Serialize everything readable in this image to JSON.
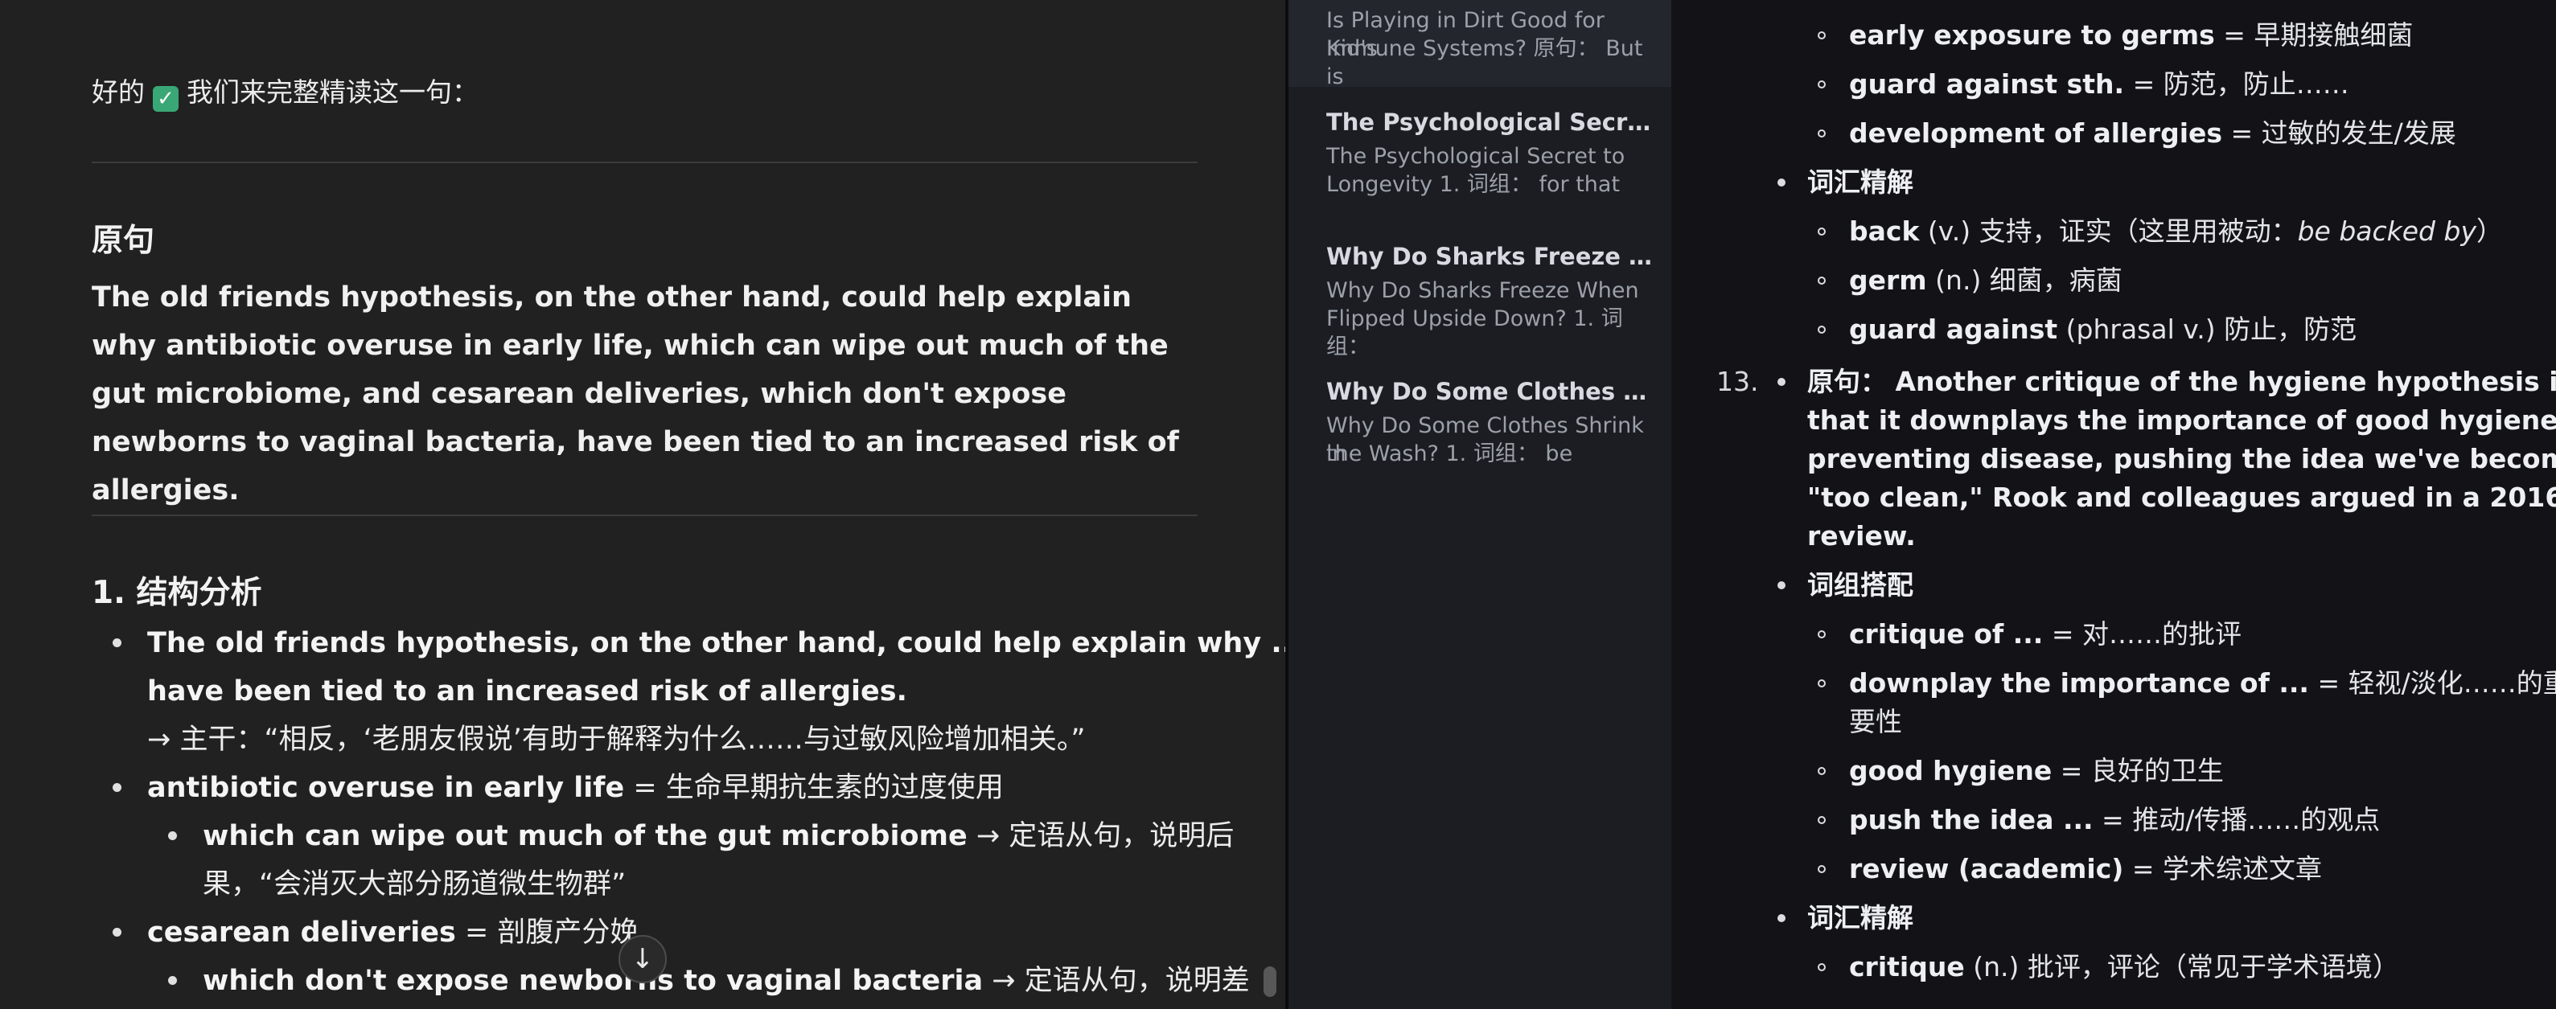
{
  "chat": {
    "intro_pre": "好的",
    "intro_post": "我们来完整精读这一句：",
    "original_heading": "原句",
    "original_sentence": "The old friends hypothesis, on the other hand, could help explain why antibiotic overuse in early life, which can wipe out much of the gut microbiome, and cesarean deliveries, which don't expose newborns to vaginal bacteria, have been tied to an increased risk of allergies.",
    "analysis_heading": "1. 结构分析",
    "items": [
      {
        "b1": "The old friends hypothesis, on the other hand, could help explain why ...",
        "b2": "have been tied to an increased risk of allergies.",
        "note": "→ 主干：“相反，‘老朋友假说’有助于解释为什么……与过敏风险增加相关。”"
      },
      {
        "b": "antibiotic overuse in early life",
        "t": " = 生命早期抗生素的过度使用"
      },
      {
        "b": "which can wipe out much of the gut microbiome",
        "t": " → 定语从句，说明后",
        "t2": "果，“会消灭大部分肠道微生物群”"
      },
      {
        "b": "cesarean deliveries",
        "t": " = 剖腹产分娩"
      },
      {
        "b": "which don't expose newborns to vaginal bacteria",
        "t": " → 定语从句，说明差"
      }
    ],
    "scroll_icon": "arrow-down-icon"
  },
  "sidebar": {
    "items": [
      {
        "title": "",
        "snippet1": "Is Playing in Dirt Good for Kid's",
        "snippet2": "Immune Systems? 原句： But is"
      },
      {
        "title": "The Psychological Secret to Longevity",
        "snippet1": "The Psychological Secret to",
        "snippet2": "Longevity 1. 词组： for that"
      },
      {
        "title": "Why Do Sharks Freeze When Flipped Upside Down?",
        "snippet1": "Why Do Sharks Freeze When",
        "snippet2": "Flipped Upside Down? 1. 词组："
      },
      {
        "title": "Why Do Some Clothes Shrink in the Wash?",
        "snippet1": "Why Do Some Clothes Shrink in",
        "snippet2": "the Wash? 1. 词组： be"
      }
    ]
  },
  "notes": {
    "phrases_top": [
      {
        "b": "early exposure to germs",
        "t": " = 早期接触细菌"
      },
      {
        "b": "guard against sth.",
        "t": " = 防范，防止……"
      },
      {
        "b": "development of allergies",
        "t": " = 过敏的发生/发展"
      }
    ],
    "vocab_label": "词汇精解",
    "vocab_top": [
      {
        "b": "back",
        "t": " (v.) 支持，证实（这里用被动：",
        "i": "be backed by",
        "t2": "）"
      },
      {
        "b": "germ",
        "t": " (n.) 细菌，病菌"
      },
      {
        "b": "guard against",
        "t": " (phrasal v.) 防止，防范"
      }
    ],
    "item_number": "13.",
    "original_label": "原句：",
    "original_line1": "Another critique of the hygiene hypothesis is",
    "original_line2": "that it downplays the importance of good hygiene to",
    "original_line3": "preventing disease, pushing the idea we've become",
    "original_line4": "\"too clean,\" Rook and colleagues argued in a 2016",
    "original_line5": "review.",
    "phrases_label": "词组搭配",
    "phrases": [
      {
        "b": "critique of ...",
        "t": " = 对……的批评"
      },
      {
        "b": "downplay the importance of ...",
        "t": " = 轻视/淡化……的重",
        "t2": "要性"
      },
      {
        "b": "good hygiene",
        "t": " = 良好的卫生"
      },
      {
        "b": "push the idea ...",
        "t": " = 推动/传播……的观点"
      },
      {
        "b": "review (academic)",
        "t": " = 学术综述文章"
      }
    ],
    "vocab_label_2": "词汇精解",
    "vocab": [
      {
        "b": "critique",
        "t": " (n.) 批评，评论（常见于学术语境）"
      }
    ]
  }
}
